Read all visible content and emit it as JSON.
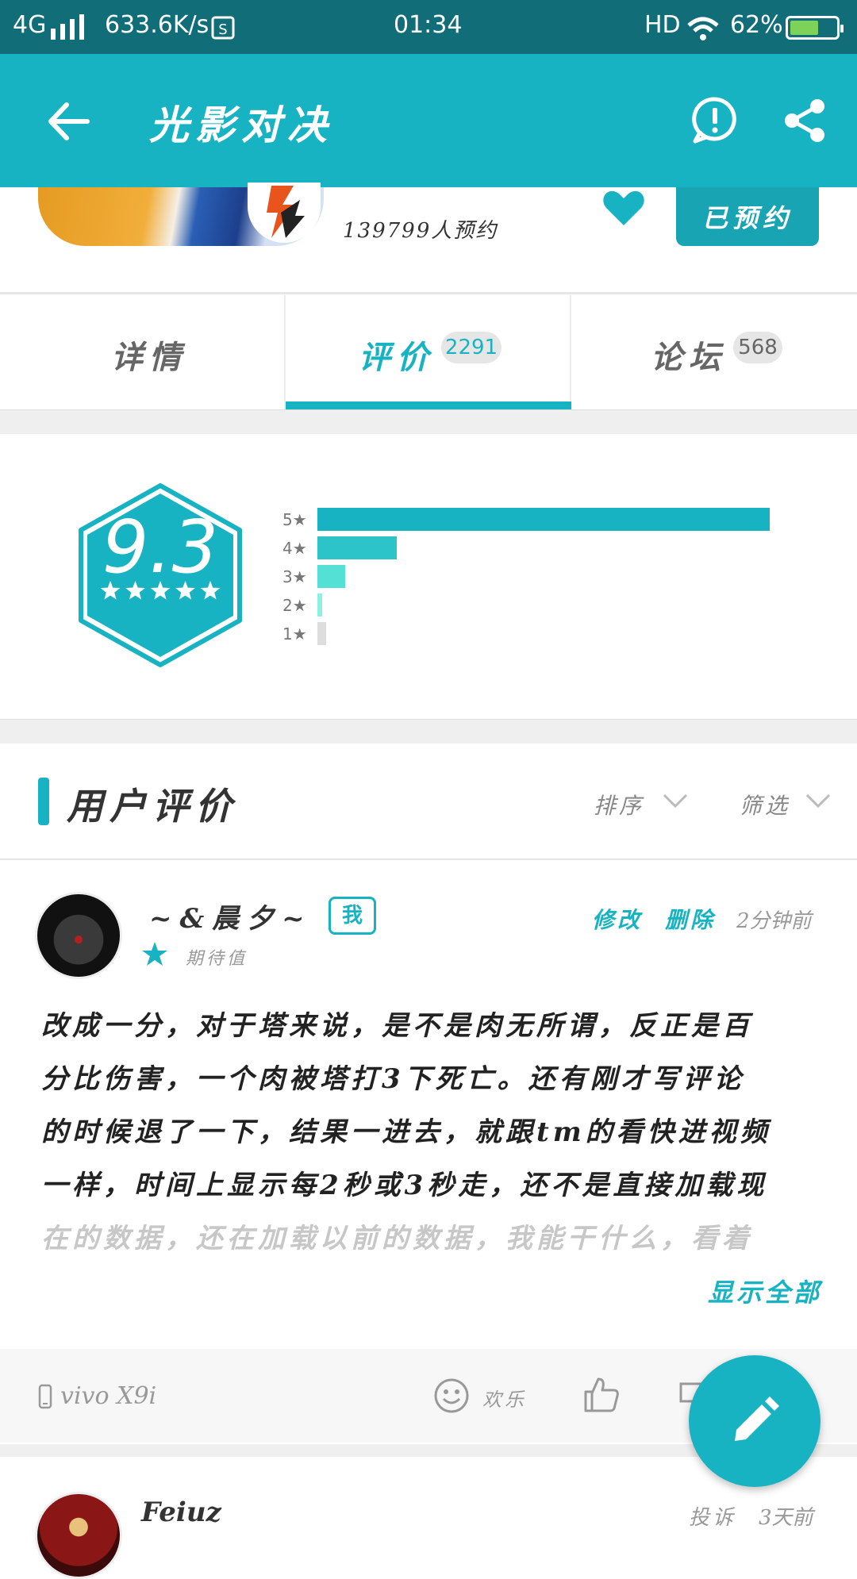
{
  "status_bar": {
    "network": "4G",
    "speed": "633.6K/s",
    "time": "01:34",
    "hd": "HD",
    "battery": "62%",
    "battery_level": 0.62
  },
  "header": {
    "title": "光影对决"
  },
  "app": {
    "reservations": "139799人预约",
    "reserved_button": "已预约"
  },
  "tabs": [
    {
      "label": "详情"
    },
    {
      "label": "评价",
      "count": "2291"
    },
    {
      "label": "论坛",
      "count": "568"
    }
  ],
  "rating": {
    "score": "9.3",
    "distribution": [
      {
        "label": "5",
        "fraction": 1.0,
        "color": "#18b3c3"
      },
      {
        "label": "4",
        "fraction": 0.175,
        "color": "#2cc4c8"
      },
      {
        "label": "3",
        "fraction": 0.062,
        "color": "#55e0d5"
      },
      {
        "label": "2",
        "fraction": 0.01,
        "color": "#8ef0e0"
      },
      {
        "label": "1",
        "fraction": 0.02,
        "color": "#dddddd"
      }
    ]
  },
  "reviews_section": {
    "title": "用户评价",
    "sort": "排序",
    "filter": "筛选"
  },
  "review": {
    "username": "~&晨夕~",
    "me_badge": "我",
    "edit": "修改",
    "delete": "删除",
    "time": "2分钟前",
    "status": "期待值",
    "lines": [
      "改成一分，对于塔来说，是不是肉无所谓，反正是百",
      "分比伤害，一个肉被塔打3下死亡。还有刚才写评论",
      "的时候退了一下，结果一进去，就跟tm的看快进视频",
      "一样，时间上显示每2秒或3秒走，还不是直接加载现"
    ],
    "faded_line": "在的数据，还在加载以前的数据，我能干什么，看着",
    "show_all": "显示全部",
    "device": "vivo X9i",
    "mood": "欢乐"
  },
  "next_review": {
    "username": "Feiuz",
    "report": "投诉",
    "time": "3天前"
  },
  "colors": {
    "accent": "#18b3c3",
    "status_bar": "#116e78"
  }
}
